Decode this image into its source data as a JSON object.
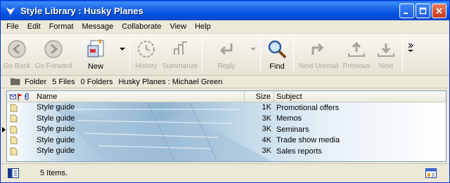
{
  "window": {
    "title": "Style Library : Husky Planes"
  },
  "menu": [
    "File",
    "Edit",
    "Format",
    "Message",
    "Collaborate",
    "View",
    "Help"
  ],
  "toolbar": {
    "go_back": "Go Back",
    "go_forward": "Go Forward",
    "new": "New",
    "history": "History",
    "summarize": "Summarize",
    "reply": "Reply",
    "find": "Find",
    "next_unread": "Next Unread",
    "previous": "Previous",
    "next": "Next"
  },
  "infobar": {
    "folder_label": "Folder",
    "files": "5 Files",
    "folders": "0 Folders",
    "path": "Husky Planes : Michael Green"
  },
  "list": {
    "columns": {
      "name": "Name",
      "size": "Size",
      "subject": "Subject"
    },
    "rows": [
      {
        "name": "Style guide",
        "size": "1K",
        "subject": "Promotional offers"
      },
      {
        "name": "Style guide",
        "size": "3K",
        "subject": "Memos"
      },
      {
        "name": "Style guide",
        "size": "3K",
        "subject": "Seminars"
      },
      {
        "name": "Style guide",
        "size": "4K",
        "subject": "Trade show media"
      },
      {
        "name": "Style guide",
        "size": "3K",
        "subject": "Sales reports"
      }
    ]
  },
  "status": {
    "text": "5 Items."
  },
  "colors": {
    "titlebar": "#0a5fe6",
    "background": "#ece9d8",
    "disabled_text": "#a8a8a0"
  }
}
